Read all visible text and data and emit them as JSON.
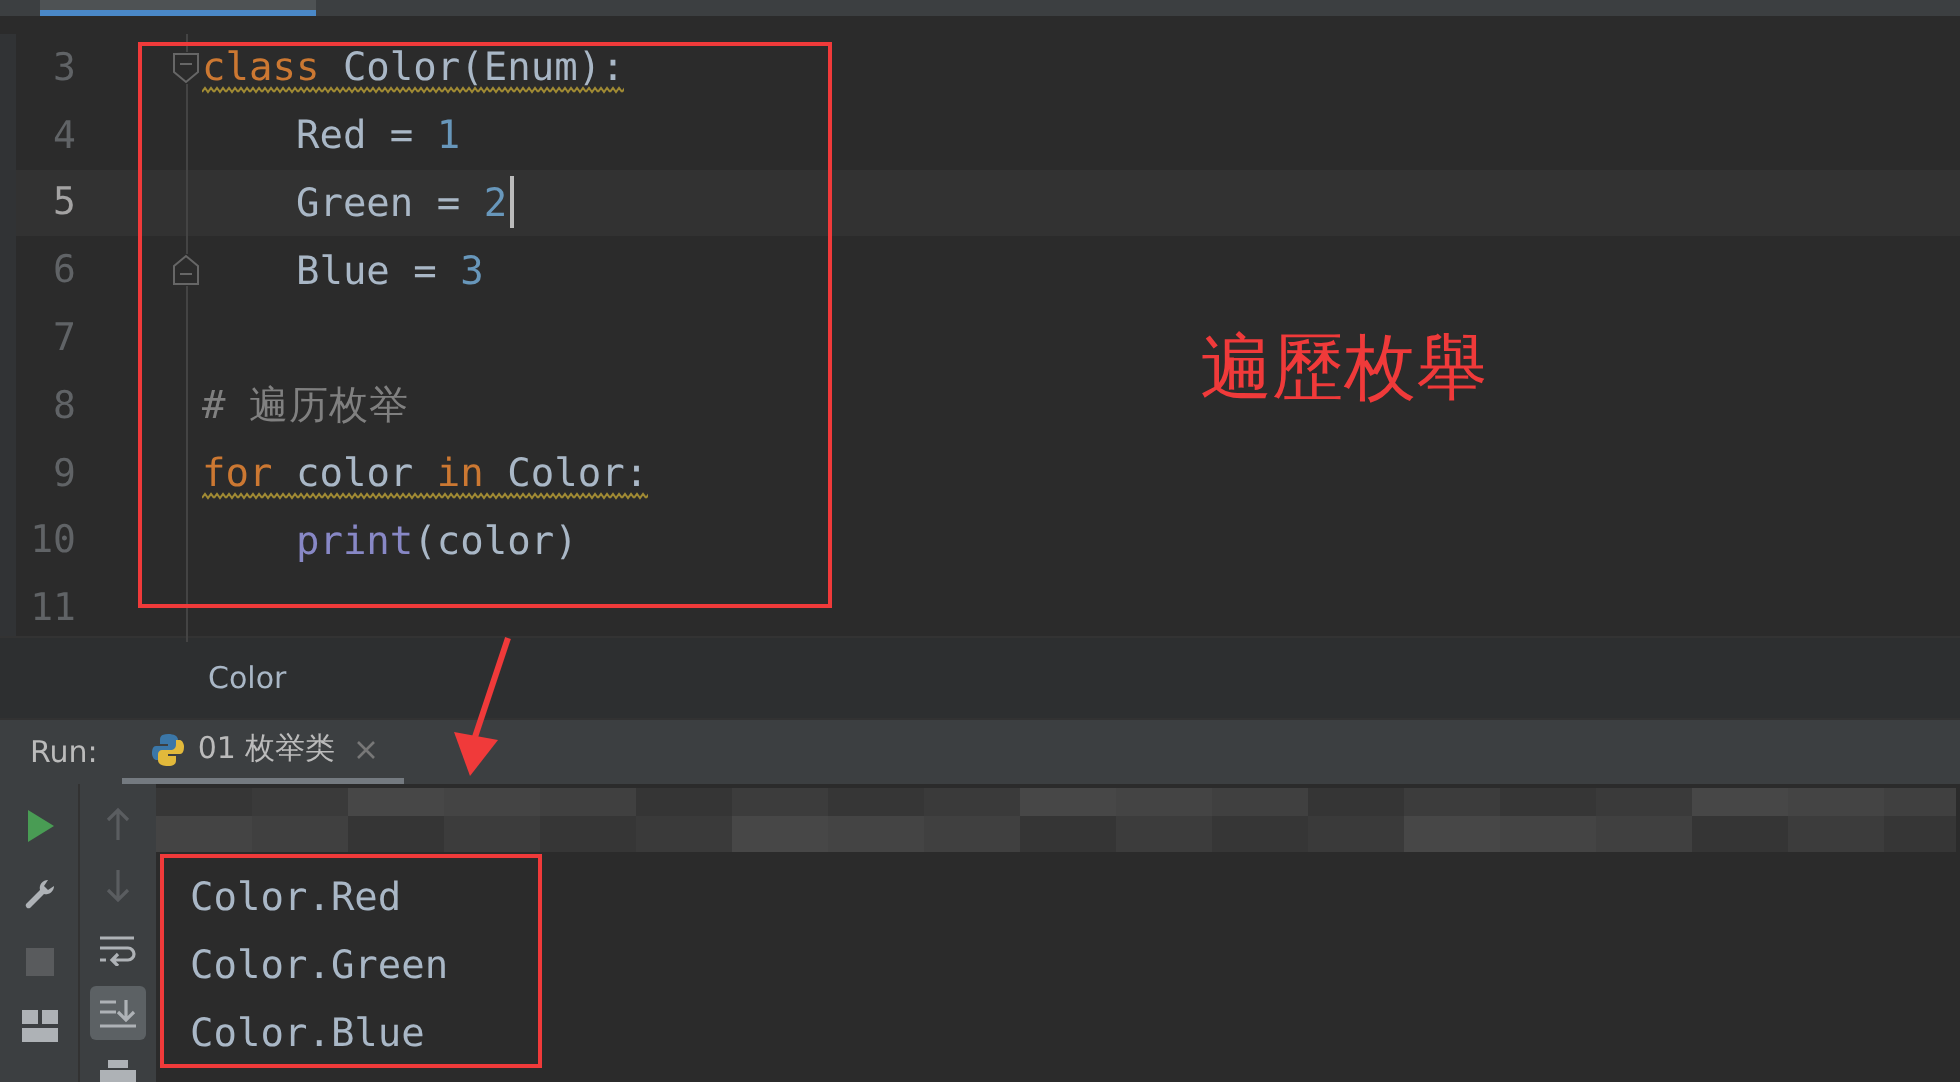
{
  "editor": {
    "lines": [
      {
        "number": "3",
        "current": false,
        "warning": true,
        "fold_start": true,
        "tokens": [
          {
            "kind": "keyword",
            "text": "class"
          },
          {
            "kind": "plain",
            "text": " Color(Enum):"
          }
        ]
      },
      {
        "number": "4",
        "current": false,
        "tokens": [
          {
            "kind": "plain",
            "text": "    Red = "
          },
          {
            "kind": "number",
            "text": "1"
          }
        ]
      },
      {
        "number": "5",
        "current": true,
        "tokens": [
          {
            "kind": "plain",
            "text": "    Green = "
          },
          {
            "kind": "number",
            "text": "2"
          }
        ]
      },
      {
        "number": "6",
        "current": false,
        "fold_end": true,
        "tokens": [
          {
            "kind": "plain",
            "text": "    Blue = "
          },
          {
            "kind": "number",
            "text": "3"
          }
        ]
      },
      {
        "number": "7",
        "current": false
      },
      {
        "number": "8",
        "current": false,
        "tokens": [
          {
            "kind": "comment",
            "text": "# 遍历枚举"
          }
        ]
      },
      {
        "number": "9",
        "current": false,
        "warning": true,
        "tokens": [
          {
            "kind": "keyword",
            "text": "for"
          },
          {
            "kind": "plain",
            "text": " color "
          },
          {
            "kind": "keyword",
            "text": "in"
          },
          {
            "kind": "plain",
            "text": " Color:"
          }
        ]
      },
      {
        "number": "10",
        "current": false,
        "tokens": [
          {
            "kind": "builtin",
            "text": "    print"
          },
          {
            "kind": "plain",
            "text": "(color)"
          }
        ]
      },
      {
        "number": "11",
        "current": false
      }
    ]
  },
  "breadcrumb": "Color",
  "annotation": {
    "label": "遍歷枚舉"
  },
  "run": {
    "label": "Run:",
    "tab": {
      "title": "01 枚举类",
      "selected": true
    },
    "toolbar_left": [
      {
        "kind": "run"
      },
      {
        "kind": "wrench"
      },
      {
        "kind": "stop"
      },
      {
        "kind": "layout"
      }
    ],
    "toolbar_right": [
      {
        "kind": "up",
        "disabled": true,
        "selected": false
      },
      {
        "kind": "down",
        "disabled": true,
        "selected": false
      },
      {
        "kind": "wrap",
        "disabled": false,
        "selected": false
      },
      {
        "kind": "scroll-end",
        "disabled": false,
        "selected": true
      },
      {
        "kind": "print",
        "disabled": false,
        "selected": false
      }
    ],
    "output": [
      "Color.Red",
      "Color.Green",
      "Color.Blue"
    ]
  }
}
